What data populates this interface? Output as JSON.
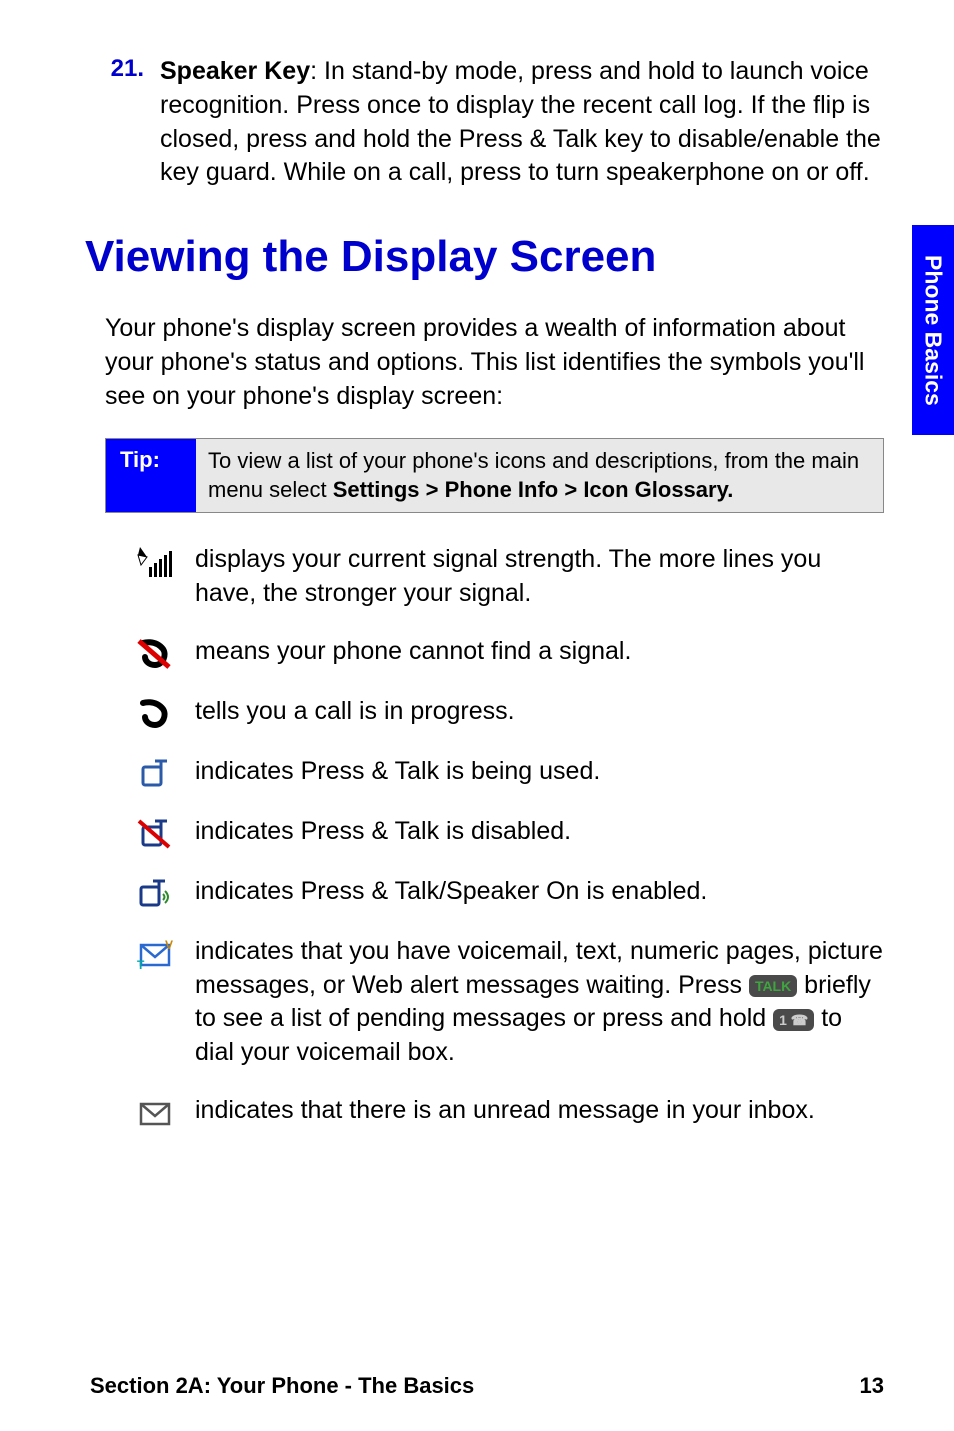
{
  "sideTab": "Phone Basics",
  "item21": {
    "num": "21.",
    "label": "Speaker Key",
    "text": ": In stand-by mode, press and hold to launch voice recognition. Press once to display the recent call log. If the flip is closed, press and hold  the Press & Talk key to disable/enable the key guard. While on a call, press to turn speakerphone on or off."
  },
  "heading": "Viewing the Display Screen",
  "intro": "Your phone's display screen provides a wealth of information about your phone's status and options. This list identifies the symbols you'll see on your phone's display screen:",
  "tip": {
    "label": "Tip:",
    "text_a": "To view a list of your phone's icons and descriptions, from the main menu select ",
    "text_b": "Settings > Phone Info > Icon Glossary."
  },
  "rows": {
    "signal": {
      "name": "signal-icon",
      "text": "displays your current signal strength. The more lines you have, the stronger your signal."
    },
    "nosignal": {
      "name": "no-signal-icon",
      "text": "means your phone cannot find a signal."
    },
    "inprogress": {
      "name": "call-in-progress-icon",
      "text": "tells you a call is in progress."
    },
    "ptt": {
      "name": "press-talk-icon",
      "text": "indicates Press & Talk is being used."
    },
    "pttdisabled": {
      "name": "press-talk-disabled-icon",
      "text": "indicates Press & Talk is disabled."
    },
    "pttspeaker": {
      "name": "press-talk-speaker-icon",
      "text": "indicates Press & Talk/Speaker On is enabled."
    },
    "messages": {
      "name": "messages-waiting-icon",
      "t1": "indicates that you have voicemail, text, numeric pages, picture messages, or Web alert messages waiting. Press ",
      "t2": " briefly to see a list of pending messages or press and hold ",
      "t3": " to dial your voicemail box.",
      "btnTalk": "TALK",
      "btn1": "1 ☎"
    },
    "unread": {
      "name": "unread-message-icon",
      "text": "indicates that there is an unread message in your inbox."
    }
  },
  "footer": {
    "section": "Section 2A: Your Phone - The Basics",
    "page": "13"
  }
}
